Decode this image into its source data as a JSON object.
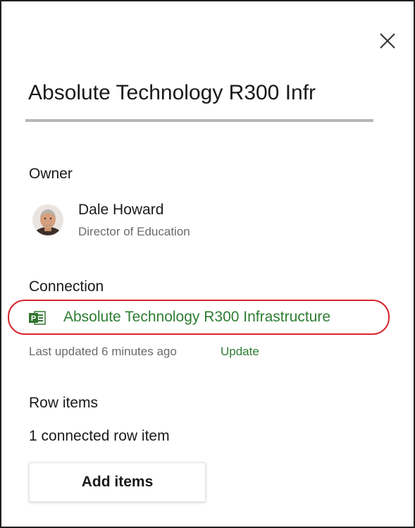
{
  "header": {
    "title": "Absolute Technology R300 Infr",
    "close_icon": "close-icon"
  },
  "owner": {
    "heading": "Owner",
    "name": "Dale Howard",
    "job_title": "Director of Education",
    "avatar_icon": "person-avatar"
  },
  "connection": {
    "heading": "Connection",
    "icon": "project-icon",
    "link_label": "Absolute Technology R300 Infrastructure",
    "last_updated": "Last updated 6 minutes ago",
    "update_label": "Update",
    "highlight_color": "#d7262f",
    "link_color": "#2e7d32"
  },
  "row_items": {
    "heading": "Row items",
    "count_text": "1 connected row item",
    "add_button_label": "Add items"
  }
}
